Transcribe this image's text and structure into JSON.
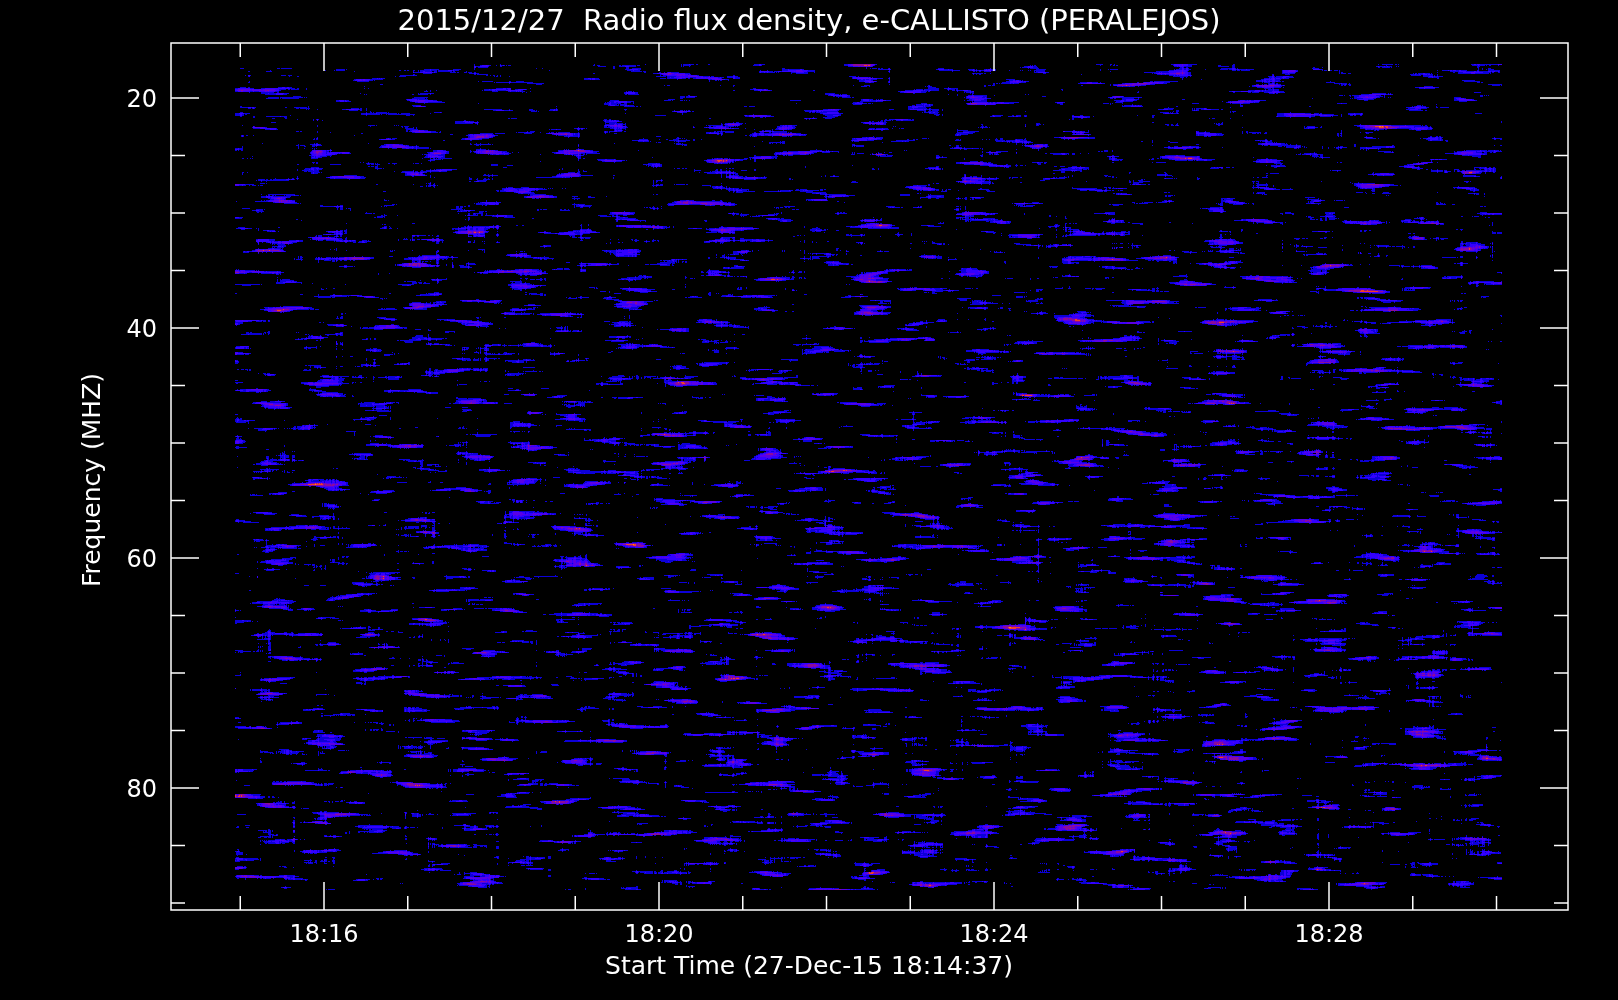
{
  "title": "2015/12/27  Radio flux density, e-CALLISTO (PERALEJOS)",
  "y_axis": {
    "label": "Frequency (MHZ)",
    "ticks": [
      "20",
      "40",
      "60",
      "80"
    ]
  },
  "x_axis": {
    "label": "Start Time (27-Dec-15 18:14:37)",
    "ticks": [
      "18:16",
      "18:20",
      "18:24",
      "18:28"
    ]
  }
}
